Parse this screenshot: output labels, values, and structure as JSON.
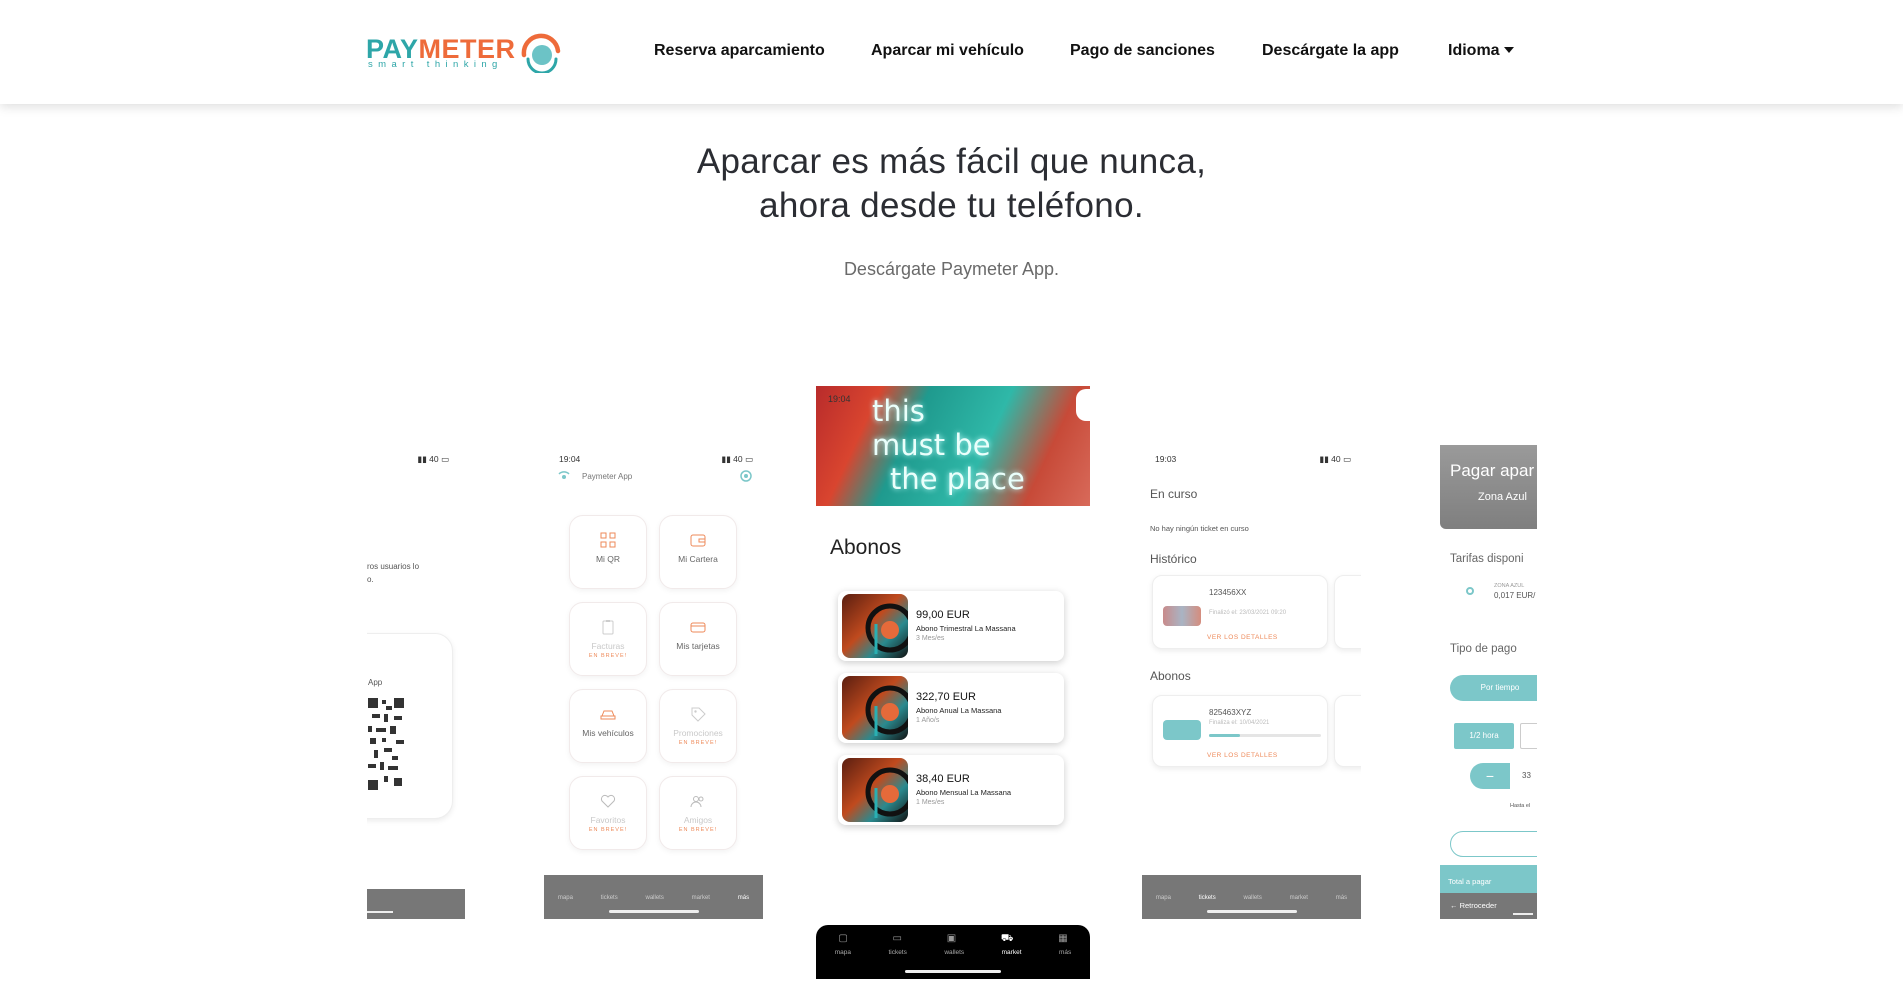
{
  "header": {
    "logo": {
      "brand_first": "PAY",
      "brand_second": "METER",
      "tagline": "smart thinking"
    },
    "nav": [
      {
        "label": "Reserva aparcamiento"
      },
      {
        "label": "Aparcar mi vehículo"
      },
      {
        "label": "Pago de sanciones"
      },
      {
        "label": "Descárgate la app"
      },
      {
        "label": "Idioma"
      }
    ]
  },
  "hero": {
    "title_line1": "Aparcar es más fácil que nunca,",
    "title_line2": "ahora desde tu teléfono.",
    "subtitle": "Descárgate Paymeter App."
  },
  "screen1": {
    "status_right": "40",
    "text_line1": "ros usuarios lo",
    "text_line2": "o.",
    "card_label": "App"
  },
  "screen2": {
    "time": "19:04",
    "status_right": "40",
    "app_title": "Paymeter App",
    "tiles": [
      {
        "label": "Mi QR",
        "soon": ""
      },
      {
        "label": "Mi Cartera",
        "soon": ""
      },
      {
        "label": "Facturas",
        "soon": "EN BREVE!"
      },
      {
        "label": "Mis tarjetas",
        "soon": ""
      },
      {
        "label": "Mis vehículos",
        "soon": ""
      },
      {
        "label": "Promociones",
        "soon": "EN BREVE!"
      },
      {
        "label": "Favoritos",
        "soon": "EN BREVE!"
      },
      {
        "label": "Amigos",
        "soon": "EN BREVE!"
      }
    ],
    "tabs": [
      "mapa",
      "tickets",
      "wallets",
      "market",
      "más"
    ]
  },
  "screen3": {
    "time": "19:04",
    "neon_line1": "this",
    "neon_line2": "must be",
    "neon_line3": "the place",
    "section_title": "Abonos",
    "abonos": [
      {
        "price": "99,00 EUR",
        "desc": "Abono Trimestral La Massana",
        "duration": "3 Mes/es"
      },
      {
        "price": "322,70 EUR",
        "desc": "Abono Anual La Massana",
        "duration": "1 Año/s"
      },
      {
        "price": "38,40 EUR",
        "desc": "Abono Mensual La Massana",
        "duration": "1 Mes/es"
      }
    ],
    "tabs": [
      "mapa",
      "tickets",
      "wallets",
      "market",
      "más"
    ]
  },
  "screen4": {
    "time": "19:03",
    "status_right": "40",
    "en_curso": "En curso",
    "no_ticket": "No hay ningún ticket en curso",
    "historico": "Histórico",
    "ticket1_plate": "123456XX",
    "ticket1_date": "Finalizó el: 23/03/2021 09:20",
    "details": "VER LOS DETALLES",
    "abonos": "Abonos",
    "ticket2_plate": "825463XYZ",
    "ticket2_date": "Finaliza el: 10/04/2021",
    "tabs": [
      "mapa",
      "tickets",
      "wallets",
      "market",
      "más"
    ]
  },
  "screen5": {
    "banner_title": "Pagar apar",
    "banner_sub": "Zona Azul",
    "tarifas": "Tarifas disponi",
    "zone_label": "ZONA AZUL",
    "zone_price": "0,017 EUR/",
    "tipo_pago": "Tipo de pago",
    "btn_time": "Por tiempo",
    "btn_half": "1/2 hora",
    "stepper_value": "33",
    "hasta": "Hasta el",
    "total": "Total a pagar",
    "back": "Retroceder"
  }
}
